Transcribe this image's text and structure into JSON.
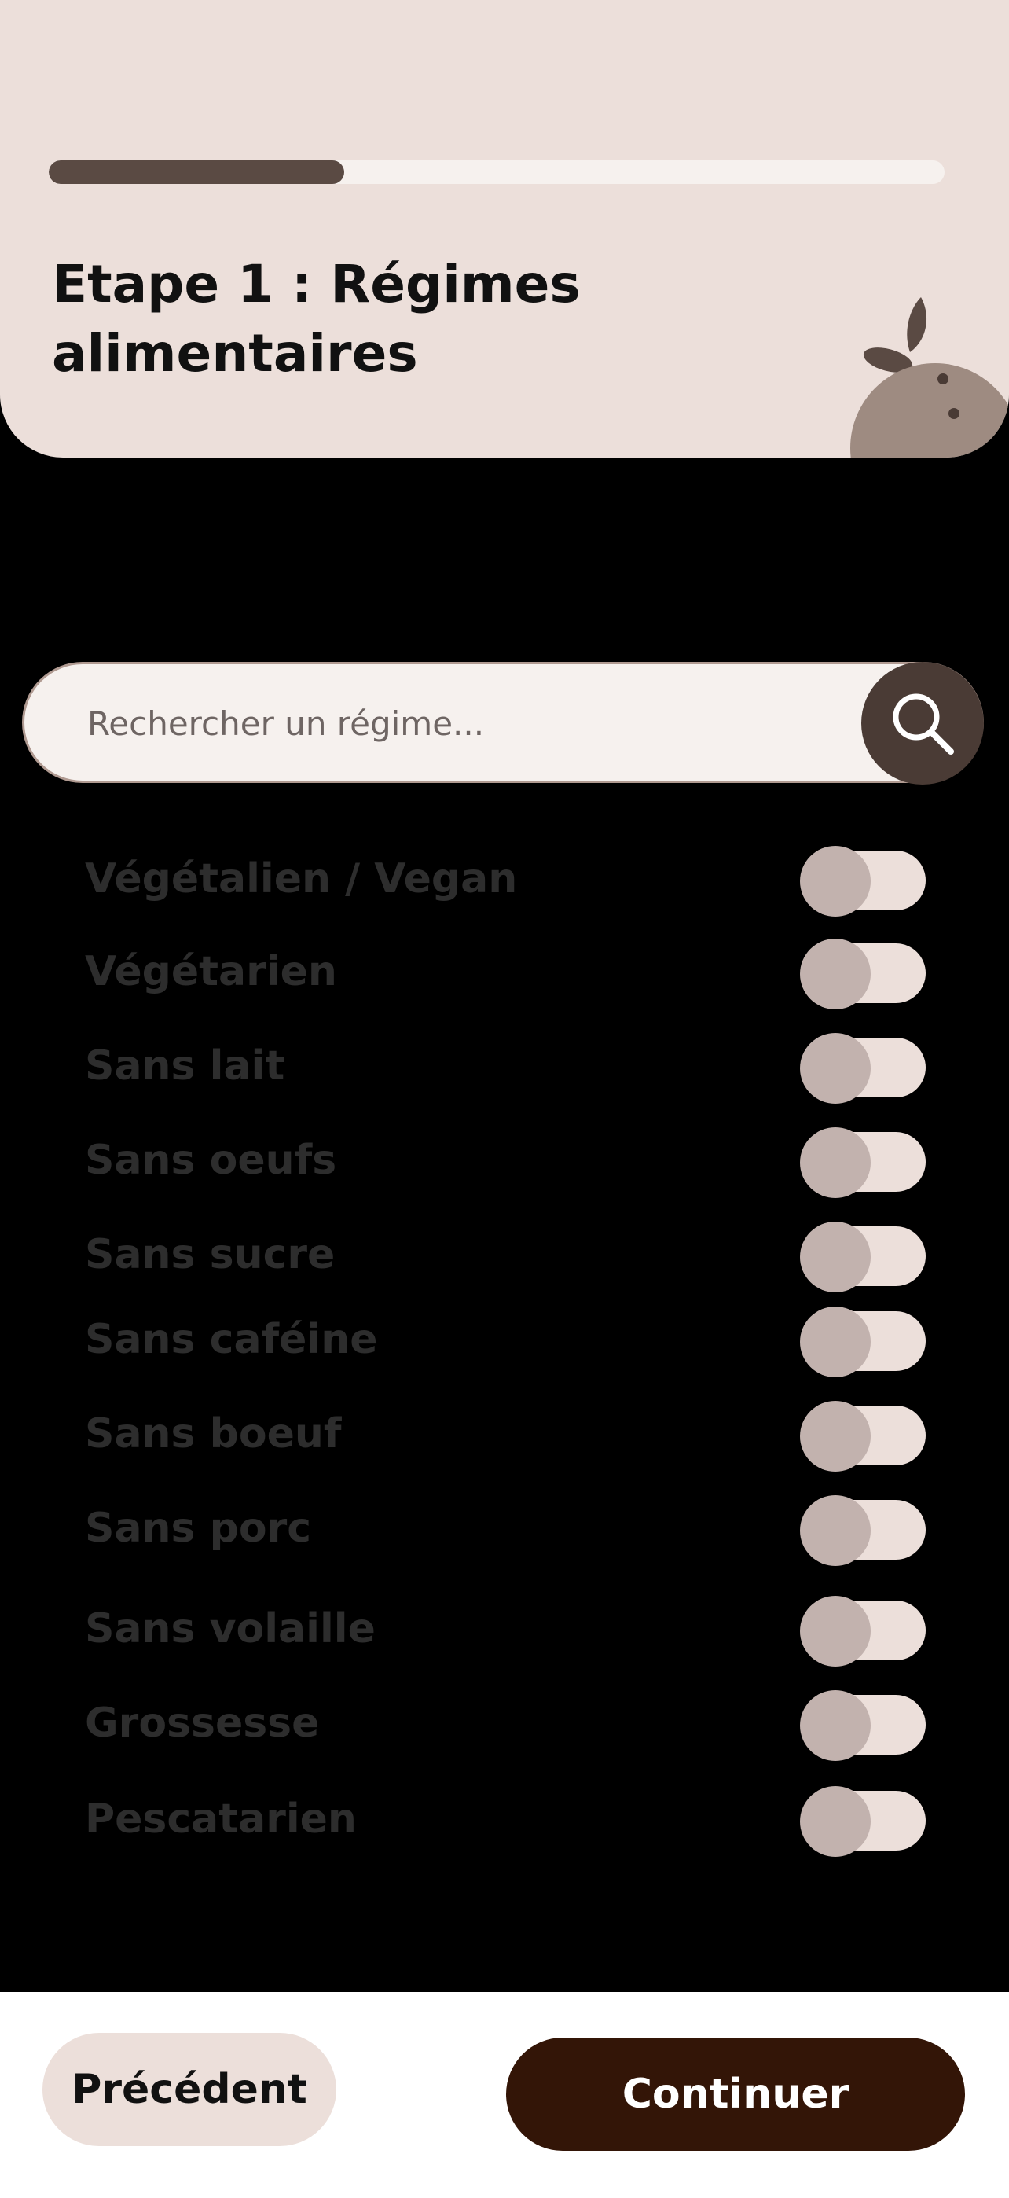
{
  "header": {
    "progress": 0.33,
    "title": "Etape 1 : Régimes alimentaires"
  },
  "search": {
    "placeholder": "Rechercher un régime...",
    "icon": "search-icon"
  },
  "diets": [
    {
      "label": "Végétalien / Vegan",
      "enabled": false
    },
    {
      "label": "Végétarien",
      "enabled": false
    },
    {
      "label": "Sans lait",
      "enabled": false
    },
    {
      "label": "Sans oeufs",
      "enabled": false
    },
    {
      "label": "Sans sucre",
      "enabled": false
    },
    {
      "label": "Sans caféine",
      "enabled": false
    },
    {
      "label": "Sans boeuf",
      "enabled": false
    },
    {
      "label": "Sans porc",
      "enabled": false
    },
    {
      "label": "Sans volaille",
      "enabled": false
    },
    {
      "label": "Grossesse",
      "enabled": false
    },
    {
      "label": "Pescatarien",
      "enabled": false
    }
  ],
  "footer": {
    "previous_label": "Précédent",
    "continue_label": "Continuer"
  },
  "colors": {
    "header_bg": "#ecdfda",
    "progress_fill": "#5a4a43",
    "primary_button": "#331507",
    "toggle_knob": "#c2b2ae"
  }
}
